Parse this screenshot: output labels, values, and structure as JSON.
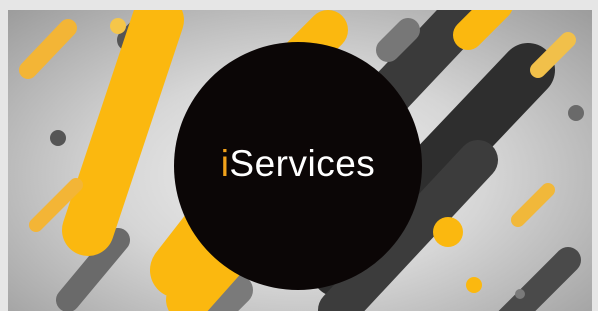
{
  "banner": {
    "brand_prefix": "i",
    "brand_suffix": "Services"
  },
  "colors": {
    "accent": "#fbb80f",
    "accent_i": "#f2a21a",
    "circle": "#0b0606",
    "dark_stripe": "#3a3a3a",
    "mid_stripe": "#6f6f6f"
  }
}
